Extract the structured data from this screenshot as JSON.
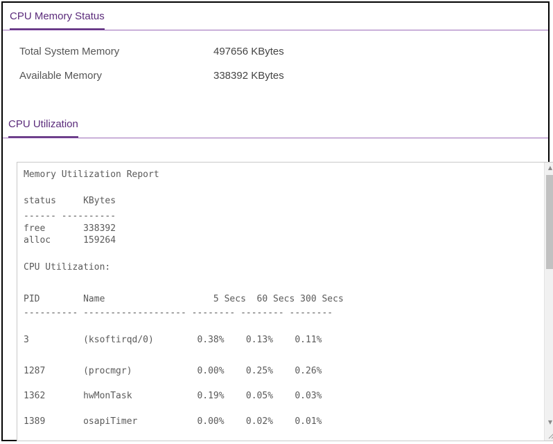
{
  "cpu_memory_status": {
    "title": "CPU Memory Status",
    "rows": [
      {
        "label": "Total System Memory",
        "value": "497656 KBytes"
      },
      {
        "label": "Available Memory",
        "value": "338392 KBytes"
      }
    ]
  },
  "cpu_utilization": {
    "title": "CPU Utilization"
  },
  "report": {
    "heading": "Memory Utilization Report",
    "mem_header": "status     KBytes",
    "mem_separator": "------ ----------",
    "mem_rows": [
      "free       338392",
      "alloc      159264"
    ],
    "cpu_title": "CPU Utilization:",
    "cpu_header": "PID        Name                    5 Secs  60 Secs 300 Secs",
    "cpu_separator": "---------- ------------------- -------- -------- --------",
    "cpu_rows": [
      "3          (ksoftirqd/0)        0.38%    0.13%    0.11%",
      "1287       (procmgr)            0.00%    0.25%    0.26%",
      "1362       hwMonTask            0.19%    0.05%    0.03%",
      "1389       osapiTimer           0.00%    0.02%    0.01%"
    ]
  },
  "icons": {
    "scroll_up": "chevron-up-icon",
    "scroll_down": "chevron-down-icon",
    "resize": "resize-grip-icon"
  }
}
